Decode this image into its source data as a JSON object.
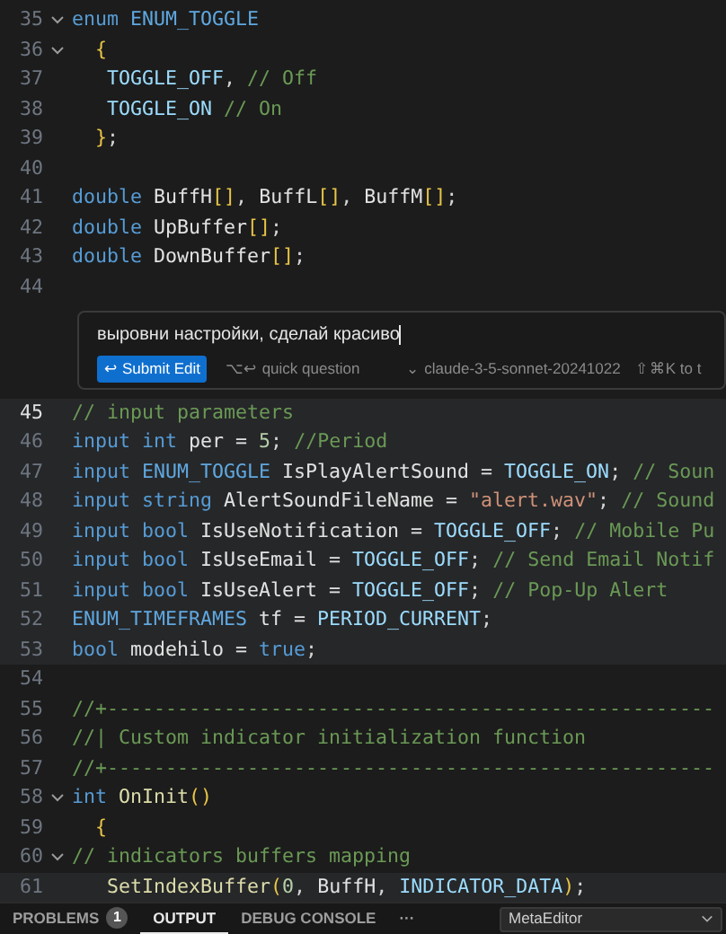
{
  "code_top": [
    {
      "n": "35",
      "fold": true,
      "active": false,
      "highlighted": false,
      "tokens": [
        {
          "kind": "kw",
          "t": "enum "
        },
        {
          "kind": "type",
          "t": "ENUM_TOGGLE"
        }
      ]
    },
    {
      "n": "36",
      "fold": true,
      "active": false,
      "highlighted": false,
      "tokens": [
        {
          "kind": "br",
          "t": "  {"
        }
      ]
    },
    {
      "n": "37",
      "fold": false,
      "active": false,
      "highlighted": false,
      "tokens": [
        {
          "kind": "const",
          "t": "   TOGGLE_OFF"
        },
        {
          "kind": "p",
          "t": ", "
        },
        {
          "kind": "c",
          "t": "// Off"
        }
      ]
    },
    {
      "n": "38",
      "fold": false,
      "active": false,
      "highlighted": false,
      "tokens": [
        {
          "kind": "const",
          "t": "   TOGGLE_ON "
        },
        {
          "kind": "c",
          "t": "// On"
        }
      ]
    },
    {
      "n": "39",
      "fold": false,
      "active": false,
      "highlighted": false,
      "tokens": [
        {
          "kind": "br",
          "t": "  }"
        },
        {
          "kind": "p",
          "t": ";"
        }
      ]
    },
    {
      "n": "40",
      "fold": false,
      "active": false,
      "highlighted": false
    },
    {
      "n": "41",
      "fold": false,
      "active": false,
      "highlighted": false,
      "tokens": [
        {
          "kind": "kw",
          "t": "double "
        },
        {
          "kind": "id",
          "t": "BuffH"
        },
        {
          "kind": "br",
          "t": "[]"
        },
        {
          "kind": "p",
          "t": ", "
        },
        {
          "kind": "id",
          "t": "BuffL"
        },
        {
          "kind": "br",
          "t": "[]"
        },
        {
          "kind": "p",
          "t": ", "
        },
        {
          "kind": "id",
          "t": "BuffM"
        },
        {
          "kind": "br",
          "t": "[]"
        },
        {
          "kind": "p",
          "t": ";"
        }
      ]
    },
    {
      "n": "42",
      "fold": false,
      "active": false,
      "highlighted": false,
      "tokens": [
        {
          "kind": "kw",
          "t": "double "
        },
        {
          "kind": "id",
          "t": "UpBuffer"
        },
        {
          "kind": "br",
          "t": "[]"
        },
        {
          "kind": "p",
          "t": ";"
        }
      ]
    },
    {
      "n": "43",
      "fold": false,
      "active": false,
      "highlighted": false,
      "tokens": [
        {
          "kind": "kw",
          "t": "double "
        },
        {
          "kind": "id",
          "t": "DownBuffer"
        },
        {
          "kind": "br",
          "t": "[]"
        },
        {
          "kind": "p",
          "t": ";"
        }
      ]
    },
    {
      "n": "44",
      "fold": false,
      "active": false,
      "highlighted": false
    }
  ],
  "prompt": {
    "value": "выровни настройки, сделай красиво",
    "submit": "Submit Edit",
    "submit_icon": "↩",
    "quick": "⌥↩ quick question",
    "model": "claude-3-5-sonnet-20241022",
    "model_caret": "⌄",
    "hint": "⇧⌘K to t"
  },
  "code_bottom": [
    {
      "n": "45",
      "fold": false,
      "active": true,
      "highlighted": true,
      "tokens": [
        {
          "kind": "c",
          "t": "// input parameters"
        }
      ]
    },
    {
      "n": "46",
      "fold": false,
      "active": false,
      "highlighted": true,
      "tokens": [
        {
          "kind": "kw",
          "t": "input int "
        },
        {
          "kind": "id",
          "t": "per = "
        },
        {
          "kind": "num",
          "t": "5"
        },
        {
          "kind": "p",
          "t": "; "
        },
        {
          "kind": "c",
          "t": "//Period"
        }
      ]
    },
    {
      "n": "47",
      "fold": false,
      "active": false,
      "highlighted": true,
      "tokens": [
        {
          "kind": "kw",
          "t": "input "
        },
        {
          "kind": "type",
          "t": "ENUM_TOGGLE "
        },
        {
          "kind": "id",
          "t": "IsPlayAlertSound = "
        },
        {
          "kind": "const",
          "t": "TOGGLE_ON"
        },
        {
          "kind": "p",
          "t": "; "
        },
        {
          "kind": "c",
          "t": "// Soun"
        }
      ]
    },
    {
      "n": "48",
      "fold": false,
      "active": false,
      "highlighted": true,
      "tokens": [
        {
          "kind": "kw",
          "t": "input string "
        },
        {
          "kind": "id",
          "t": "AlertSoundFileName = "
        },
        {
          "kind": "str",
          "t": "\"alert.wav\""
        },
        {
          "kind": "p",
          "t": "; "
        },
        {
          "kind": "c",
          "t": "// Sound"
        }
      ]
    },
    {
      "n": "49",
      "fold": false,
      "active": false,
      "highlighted": true,
      "tokens": [
        {
          "kind": "kw",
          "t": "input bool "
        },
        {
          "kind": "id",
          "t": "IsUseNotification = "
        },
        {
          "kind": "const",
          "t": "TOGGLE_OFF"
        },
        {
          "kind": "p",
          "t": "; "
        },
        {
          "kind": "c",
          "t": "// Mobile Pu"
        }
      ]
    },
    {
      "n": "50",
      "fold": false,
      "active": false,
      "highlighted": true,
      "tokens": [
        {
          "kind": "kw",
          "t": "input bool "
        },
        {
          "kind": "id",
          "t": "IsUseEmail = "
        },
        {
          "kind": "const",
          "t": "TOGGLE_OFF"
        },
        {
          "kind": "p",
          "t": "; "
        },
        {
          "kind": "c",
          "t": "// Send Email Notif"
        }
      ]
    },
    {
      "n": "51",
      "fold": false,
      "active": false,
      "highlighted": true,
      "tokens": [
        {
          "kind": "kw",
          "t": "input bool "
        },
        {
          "kind": "id",
          "t": "IsUseAlert = "
        },
        {
          "kind": "const",
          "t": "TOGGLE_OFF"
        },
        {
          "kind": "p",
          "t": "; "
        },
        {
          "kind": "c",
          "t": "// Pop-Up Alert"
        }
      ]
    },
    {
      "n": "52",
      "fold": false,
      "active": false,
      "highlighted": true,
      "tokens": [
        {
          "kind": "type",
          "t": "ENUM_TIMEFRAMES "
        },
        {
          "kind": "id",
          "t": "tf = "
        },
        {
          "kind": "const",
          "t": "PERIOD_CURRENT"
        },
        {
          "kind": "p",
          "t": ";"
        }
      ]
    },
    {
      "n": "53",
      "fold": false,
      "active": false,
      "highlighted": true,
      "tokens": [
        {
          "kind": "kw",
          "t": "bool "
        },
        {
          "kind": "id",
          "t": "modehilo = "
        },
        {
          "kind": "kw",
          "t": "true"
        },
        {
          "kind": "p",
          "t": ";"
        }
      ]
    },
    {
      "n": "54",
      "fold": false,
      "active": false,
      "highlighted": false
    },
    {
      "n": "55",
      "fold": false,
      "active": false,
      "highlighted": false,
      "tokens": [
        {
          "kind": "c",
          "t": "//+----------------------------------------------------"
        }
      ]
    },
    {
      "n": "56",
      "fold": false,
      "active": false,
      "highlighted": false,
      "tokens": [
        {
          "kind": "c",
          "t": "//| Custom indicator initialization function"
        }
      ]
    },
    {
      "n": "57",
      "fold": false,
      "active": false,
      "highlighted": false,
      "tokens": [
        {
          "kind": "c",
          "t": "//+----------------------------------------------------"
        }
      ]
    },
    {
      "n": "58",
      "fold": true,
      "active": false,
      "highlighted": false,
      "tokens": [
        {
          "kind": "kw",
          "t": "int "
        },
        {
          "kind": "fn",
          "t": "OnInit"
        },
        {
          "kind": "br",
          "t": "()"
        }
      ]
    },
    {
      "n": "59",
      "fold": false,
      "active": false,
      "highlighted": false,
      "tokens": [
        {
          "kind": "br",
          "t": "  {"
        }
      ]
    },
    {
      "n": "60",
      "fold": true,
      "active": false,
      "highlighted": false,
      "tokens": [
        {
          "kind": "c",
          "t": "// indicators buffers mapping"
        }
      ]
    },
    {
      "n": "61",
      "fold": false,
      "active": false,
      "highlighted": true,
      "tokens": [
        {
          "kind": "fn",
          "t": "   SetIndexBuffer"
        },
        {
          "kind": "br",
          "t": "("
        },
        {
          "kind": "num",
          "t": "0"
        },
        {
          "kind": "p",
          "t": ", "
        },
        {
          "kind": "id",
          "t": "BuffH"
        },
        {
          "kind": "p",
          "t": ", "
        },
        {
          "kind": "const",
          "t": "INDICATOR_DATA"
        },
        {
          "kind": "br",
          "t": ")"
        },
        {
          "kind": "p",
          "t": ";"
        }
      ]
    }
  ],
  "panel": {
    "tabs": [
      {
        "label": "PROBLEMS",
        "badge": "1",
        "selected": false
      },
      {
        "label": "OUTPUT",
        "selected": true
      },
      {
        "label": "DEBUG CONSOLE",
        "selected": false
      }
    ],
    "more": "···",
    "dropdown": "MetaEditor"
  }
}
